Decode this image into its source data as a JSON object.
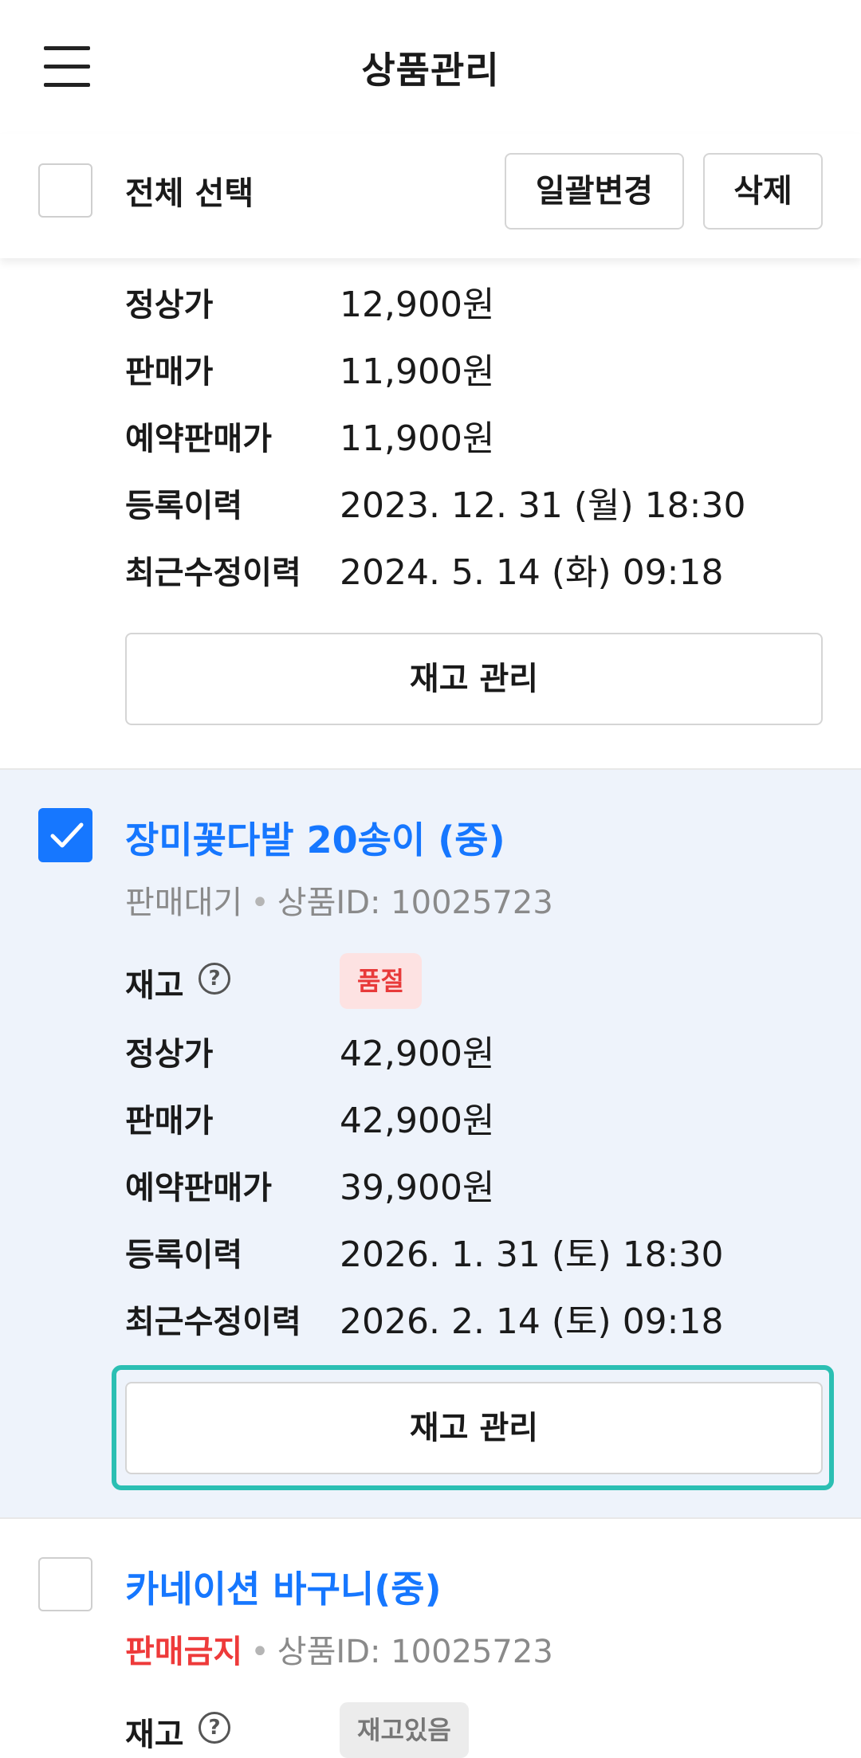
{
  "header": {
    "title": "상품관리",
    "menu_icon": "hamburger-menu-icon"
  },
  "toolbar": {
    "select_all_label": "전체 선택",
    "bulk_change_label": "일괄변경",
    "delete_label": "삭제"
  },
  "labels": {
    "stock": "재고",
    "regular_price": "정상가",
    "sale_price": "판매가",
    "reserve_price": "예약판매가",
    "registered": "등록이력",
    "modified": "최근수정이력",
    "stock_manage_button": "재고 관리"
  },
  "products": [
    {
      "regular_price": "12,900원",
      "sale_price": "11,900원",
      "reserve_price": "11,900원",
      "registered": "2023. 12. 31 (월) 18:30",
      "modified": "2024. 5. 14 (화) 09:18"
    },
    {
      "checked": true,
      "name": "장미꽃다발 20송이 (중)",
      "status": "판매대기",
      "product_id": "상품ID: 10025723",
      "stock_badge": "품절",
      "regular_price": "42,900원",
      "sale_price": "42,900원",
      "reserve_price": "39,900원",
      "registered": "2026. 1. 31 (토) 18:30",
      "modified": "2026. 2. 14 (토) 09:18"
    },
    {
      "checked": false,
      "name": "카네이션 바구니(중)",
      "status": "판매금지",
      "product_id": "상품ID: 10025723",
      "stock_badge": "재고있음"
    }
  ],
  "colors": {
    "accent": "#1677ff",
    "highlight": "#2bbfb3",
    "danger": "#ee3a3a",
    "selected_bg": "#eef3fb"
  }
}
